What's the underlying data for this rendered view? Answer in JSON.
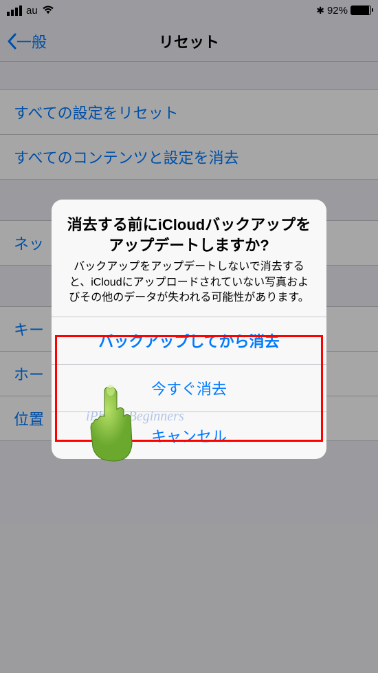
{
  "statusbar": {
    "carrier": "au",
    "bluetooth": "✻",
    "battery_pct": "92%"
  },
  "navbar": {
    "back_label": "一般",
    "title": "リセット"
  },
  "list": {
    "item1": "すべての設定をリセット",
    "item2": "すべてのコンテンツと設定を消去",
    "item3": "ネッ",
    "item4": "キー",
    "item5": "ホー",
    "item6": "位置"
  },
  "alert": {
    "title": "消去する前にiCloudバックアップをアップデートしますか?",
    "message": "バックアップをアップデートしないで消去すると、iCloudにアップロードされていない写真およびその他のデータが失われる可能性があります。",
    "btn_backup": "バックアップしてから消去",
    "btn_erase": "今すぐ消去",
    "btn_cancel": "キャンセル"
  },
  "watermark": "iPhone Beginners"
}
